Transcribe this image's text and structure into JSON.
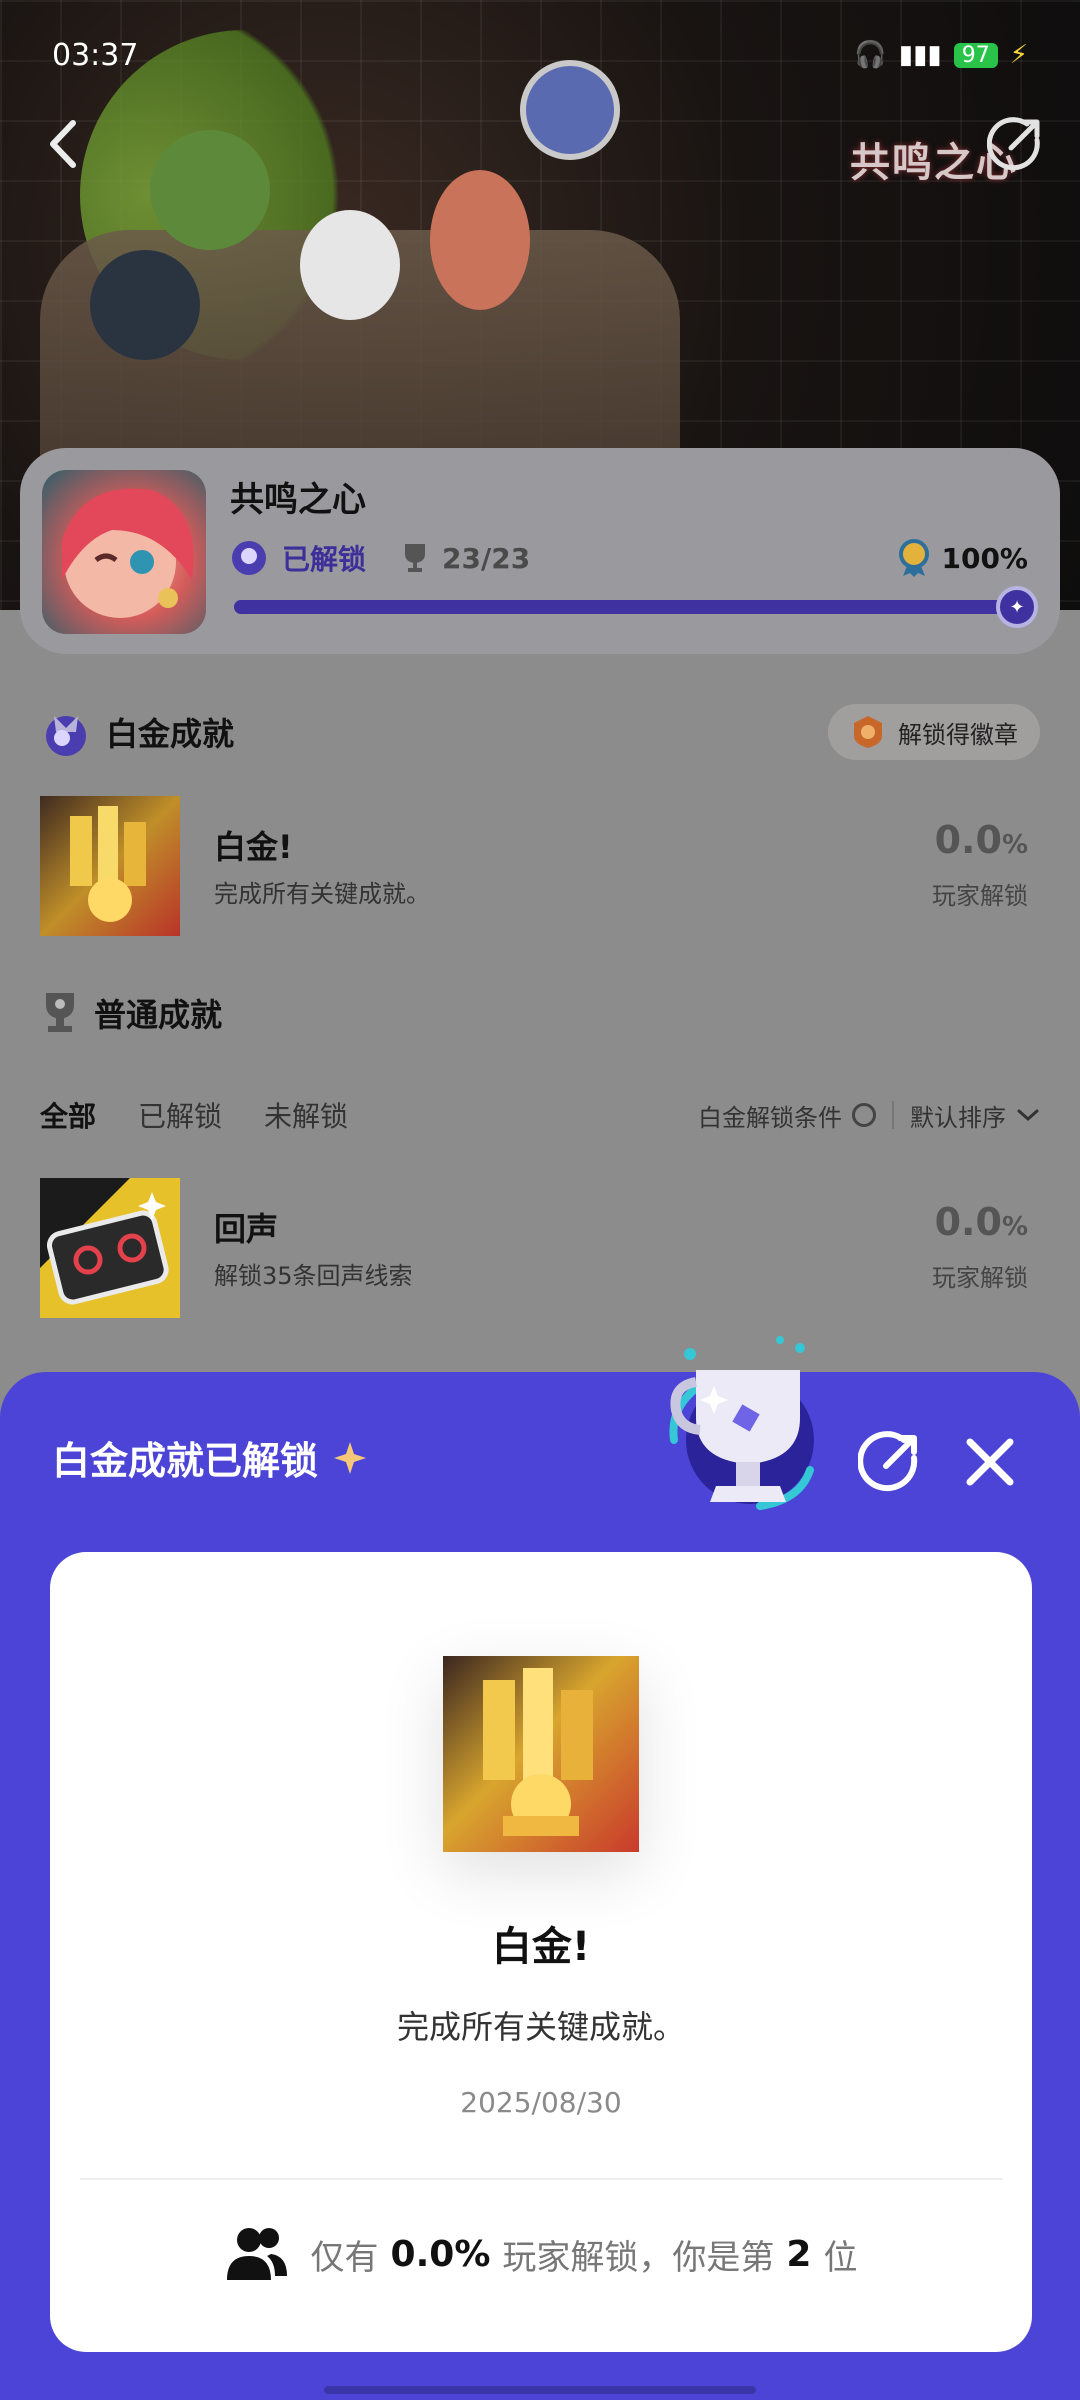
{
  "status_bar": {
    "time": "03:37",
    "battery": "97"
  },
  "hero": {
    "logo_text": "共鸣之心"
  },
  "game": {
    "title": "共鸣之心",
    "unlock_status": "已解锁",
    "trophy_count": "23/23",
    "percent": "100%",
    "progress": 1.0
  },
  "platinum_section": {
    "title": "白金成就",
    "badge_button": "解锁得徽章",
    "item": {
      "name": "白金!",
      "desc": "完成所有关键成就。",
      "pct": "0.0",
      "pct_unit": "%",
      "pct_label": "玩家解锁"
    }
  },
  "normal_section": {
    "title": "普通成就",
    "filters": [
      "全部",
      "已解锁",
      "未解锁"
    ],
    "platinum_condition": "白金解锁条件",
    "sort": "默认排序",
    "items": [
      {
        "name": "回声",
        "desc": "解锁35条回声线索",
        "pct": "0.0",
        "pct_unit": "%",
        "pct_label": "玩家解锁"
      }
    ]
  },
  "sheet": {
    "title": "白金成就已解锁",
    "card": {
      "name": "白金!",
      "desc": "完成所有关键成就。",
      "date": "2025/08/30",
      "stat_prefix": "仅有",
      "stat_pct": "0.0%",
      "stat_mid": "玩家解锁，你是第",
      "stat_rank": "2",
      "stat_suffix": "位"
    }
  },
  "colors": {
    "accent": "#4c44d6",
    "progress": "#3f32a0",
    "overlay": "#8c8c8c"
  }
}
